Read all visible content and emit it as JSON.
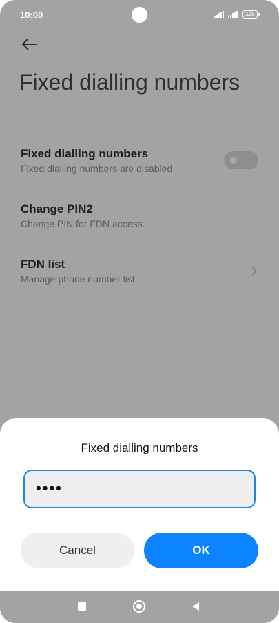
{
  "status_bar": {
    "time": "10:00",
    "battery": "100",
    "icons": [
      "signal-icon",
      "signal-icon",
      "battery-icon"
    ]
  },
  "header": {
    "back_icon": "back-arrow-icon",
    "title": "Fixed dialling numbers"
  },
  "settings": {
    "items": [
      {
        "title": "Fixed dialling numbers",
        "subtitle": "Fixed dialling numbers are disabled",
        "control": "toggle",
        "enabled": false
      },
      {
        "title": "Change PIN2",
        "subtitle": "Change PIN for FDN access"
      },
      {
        "title": "FDN list",
        "subtitle": "Manage phone number list",
        "control": "chevron-right-icon"
      }
    ]
  },
  "dialog": {
    "title": "Fixed dialling numbers",
    "pin_value": "••••",
    "cancel_label": "Cancel",
    "ok_label": "OK"
  },
  "nav_bar": {
    "icons": [
      "recent-apps-icon",
      "home-icon",
      "back-icon"
    ]
  },
  "colors": {
    "accent": "#0d84ff",
    "input_border": "#1a86e6",
    "overlay_background": "#a3a3a3"
  }
}
